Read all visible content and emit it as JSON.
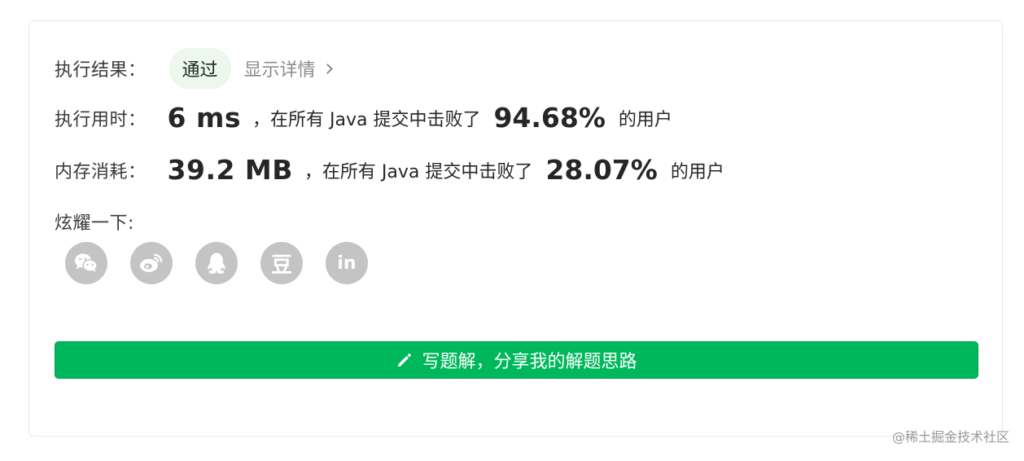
{
  "result": {
    "label": "执行结果：",
    "status": "通过",
    "details_link": "显示详情"
  },
  "runtime": {
    "label": "执行用时：",
    "value": "6 ms",
    "middle_text": "，在所有 Java 提交中击败了",
    "percent": "94.68%",
    "suffix": "的用户"
  },
  "memory": {
    "label": "内存消耗：",
    "value": "39.2 MB",
    "middle_text": "，在所有 Java 提交中击败了",
    "percent": "28.07%",
    "suffix": "的用户"
  },
  "share": {
    "label": "炫耀一下:",
    "icons": [
      "wechat-icon",
      "weibo-icon",
      "qq-icon",
      "douban-icon",
      "linkedin-icon"
    ],
    "douban_glyph": "豆",
    "linkedin_glyph": "in"
  },
  "write_button": {
    "label": "写题解，分享我的解题思路",
    "icon": "pencil-icon"
  },
  "watermark": "@稀土掘金技术社区",
  "colors": {
    "accent": "#00b85c",
    "badge_bg": "#edf7ee",
    "icon_gray": "#c4c4c4"
  }
}
